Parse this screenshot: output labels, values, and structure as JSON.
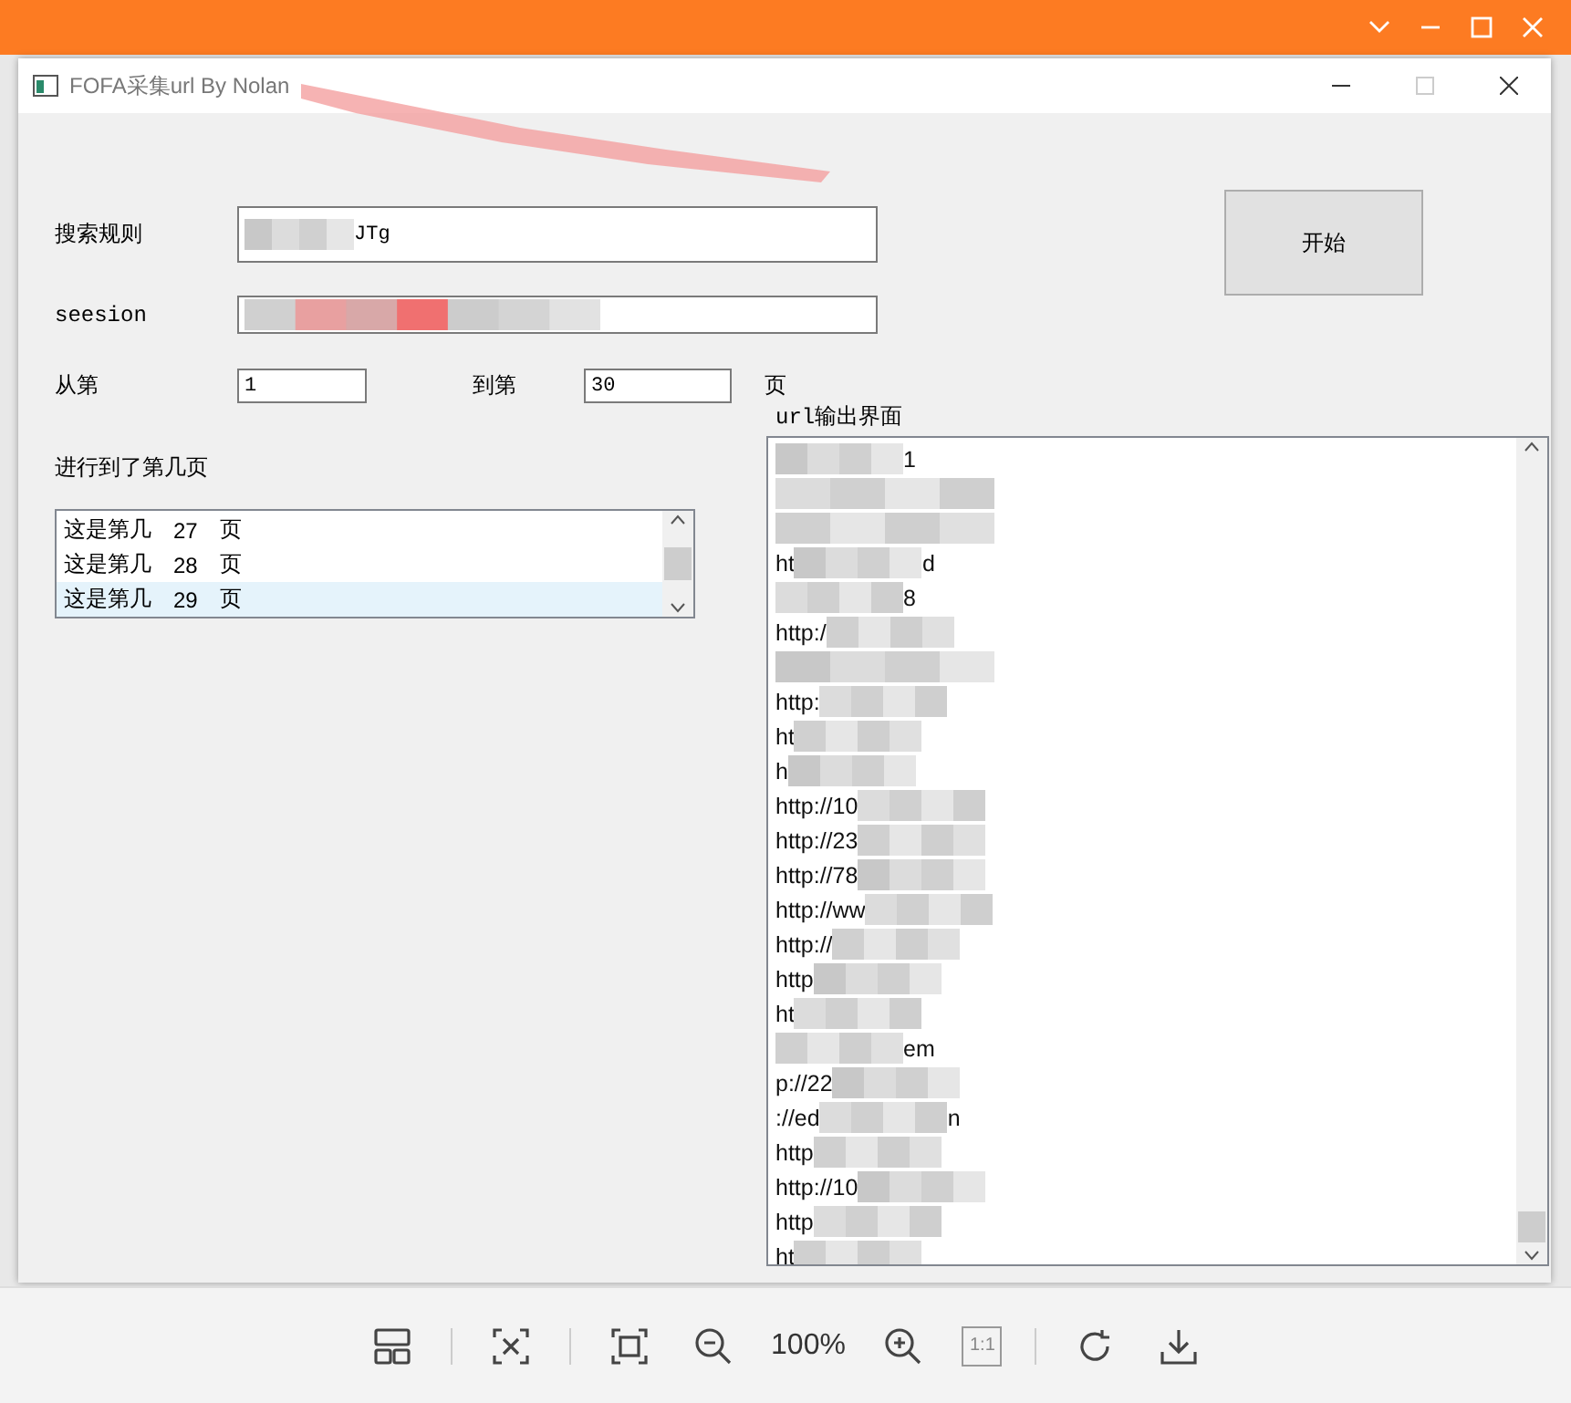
{
  "viewer": {
    "toolbar": {
      "zoom": "100%",
      "actual_size": "1:1"
    }
  },
  "window": {
    "title": "FOFA采集url By Nolan"
  },
  "form": {
    "rule_label": "搜索规则",
    "rule_value": "JTg",
    "session_label": "seesion",
    "from_label": "从第",
    "from_value": "1",
    "to_label": "到第",
    "to_value": "30",
    "page_unit": "页",
    "start_button": "开始",
    "progress_label": "进行到了第几页",
    "output_label": "url输出界面"
  },
  "progress_list": [
    {
      "prefix": "这是第几",
      "page": "27",
      "unit": "页",
      "selected": false
    },
    {
      "prefix": "这是第几",
      "page": "28",
      "unit": "页",
      "selected": false
    },
    {
      "prefix": "这是第几",
      "page": "29",
      "unit": "页",
      "selected": true
    }
  ],
  "url_lines": [
    {
      "kind": "text",
      "end": "1"
    },
    {
      "kind": "masked"
    },
    {
      "kind": "masked"
    },
    {
      "kind": "text",
      "start": "ht",
      "end": "d"
    },
    {
      "kind": "text",
      "end": "8"
    },
    {
      "kind": "text",
      "start": "http:/"
    },
    {
      "kind": "masked"
    },
    {
      "kind": "text",
      "start": "http:"
    },
    {
      "kind": "text",
      "start": "ht"
    },
    {
      "kind": "text",
      "start": "h"
    },
    {
      "kind": "text",
      "start": "http://10"
    },
    {
      "kind": "text",
      "start": "http://23"
    },
    {
      "kind": "text",
      "start": "http://78"
    },
    {
      "kind": "text",
      "start": "http://ww"
    },
    {
      "kind": "text",
      "start": "http://"
    },
    {
      "kind": "text",
      "start": "http"
    },
    {
      "kind": "text",
      "start": "ht"
    },
    {
      "kind": "text",
      "end": "em"
    },
    {
      "kind": "text",
      "start": "p://22"
    },
    {
      "kind": "text",
      "start": "://ed",
      "end": "n"
    },
    {
      "kind": "text",
      "start": "http"
    },
    {
      "kind": "text",
      "start": "http://10"
    },
    {
      "kind": "text",
      "start": "http"
    },
    {
      "kind": "text",
      "start": "ht"
    }
  ]
}
